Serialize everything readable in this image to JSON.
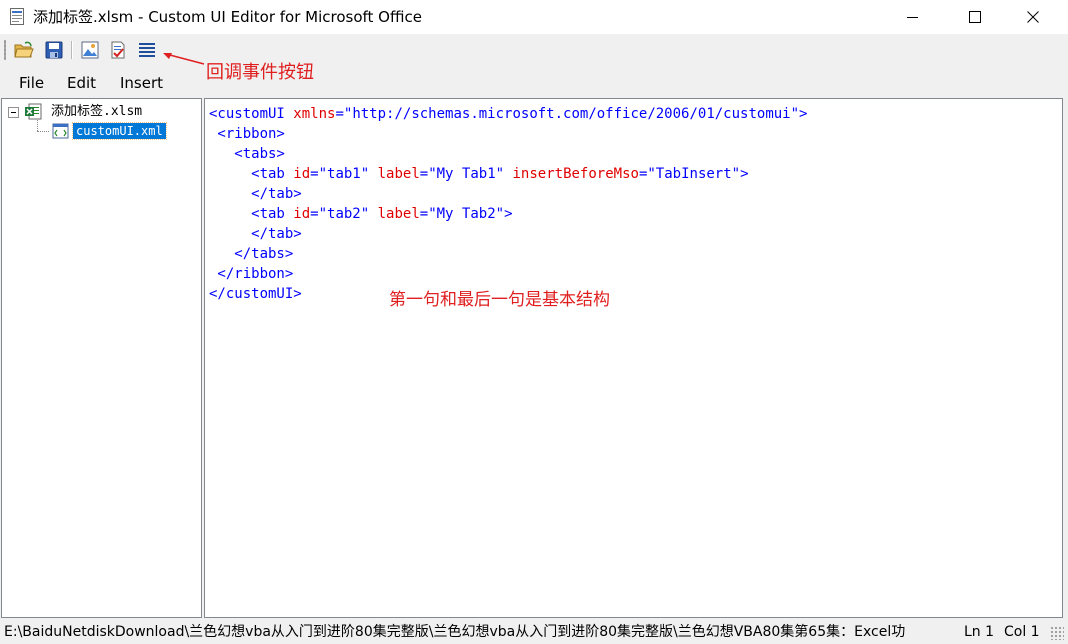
{
  "window": {
    "title": "添加标签.xlsm - Custom UI Editor for Microsoft Office"
  },
  "toolbar": {
    "buttons": [
      {
        "name": "open",
        "icon": "folder-open-icon"
      },
      {
        "name": "save",
        "icon": "save-icon"
      },
      {
        "name": "insert-icons",
        "icon": "insert-image-icon"
      },
      {
        "name": "validate",
        "icon": "validate-icon"
      },
      {
        "name": "generate-callbacks",
        "icon": "generate-callbacks-icon"
      }
    ]
  },
  "annotations": {
    "callback_button": "回调事件按钮",
    "basic_structure": "第一句和最后一句是基本结构"
  },
  "menu": {
    "items": [
      "File",
      "Edit",
      "Insert"
    ]
  },
  "tree": {
    "root_label": "添加标签.xlsm",
    "child_label": "customUI.xml"
  },
  "editor": {
    "lines": [
      [
        {
          "c": "tag",
          "t": "<customUI "
        },
        {
          "c": "attr",
          "t": "xmlns"
        },
        {
          "c": "sym",
          "t": "="
        },
        {
          "c": "str",
          "t": "\"http://schemas.microsoft.com/office/2006/01/customui\""
        },
        {
          "c": "tag",
          "t": ">"
        }
      ],
      [
        {
          "c": "tag",
          "t": " <ribbon>"
        }
      ],
      [
        {
          "c": "tag",
          "t": "   <tabs>"
        }
      ],
      [
        {
          "c": "tag",
          "t": "     <tab "
        },
        {
          "c": "attr",
          "t": "id"
        },
        {
          "c": "sym",
          "t": "="
        },
        {
          "c": "str",
          "t": "\"tab1\" "
        },
        {
          "c": "attr",
          "t": "label"
        },
        {
          "c": "sym",
          "t": "="
        },
        {
          "c": "str",
          "t": "\"My Tab1\" "
        },
        {
          "c": "attr",
          "t": "insertBeforeMso"
        },
        {
          "c": "sym",
          "t": "="
        },
        {
          "c": "str",
          "t": "\"TabInsert\""
        },
        {
          "c": "tag",
          "t": ">"
        }
      ],
      [
        {
          "c": "tag",
          "t": "     </tab>"
        }
      ],
      [
        {
          "c": "tag",
          "t": "     <tab "
        },
        {
          "c": "attr",
          "t": "id"
        },
        {
          "c": "sym",
          "t": "="
        },
        {
          "c": "str",
          "t": "\"tab2\" "
        },
        {
          "c": "attr",
          "t": "label"
        },
        {
          "c": "sym",
          "t": "="
        },
        {
          "c": "str",
          "t": "\"My Tab2\""
        },
        {
          "c": "tag",
          "t": ">"
        }
      ],
      [
        {
          "c": "tag",
          "t": "     </tab>"
        }
      ],
      [
        {
          "c": "tag",
          "t": "   </tabs>"
        }
      ],
      [
        {
          "c": "tag",
          "t": " </ribbon>"
        }
      ],
      [
        {
          "c": "tag",
          "t": "</customUI>"
        }
      ]
    ]
  },
  "status": {
    "path": "E:\\BaiduNetdiskDownload\\兰色幻想vba从入门到进阶80集完整版\\兰色幻想vba从入门到进阶80集完整版\\兰色幻想VBA80集第65集：Excel功",
    "ln": "Ln 1",
    "col": "Col 1"
  },
  "colors": {
    "tag": "#0000ff",
    "attribute": "#e00000",
    "annotation": "#e02020",
    "selection": "#0078d7"
  }
}
